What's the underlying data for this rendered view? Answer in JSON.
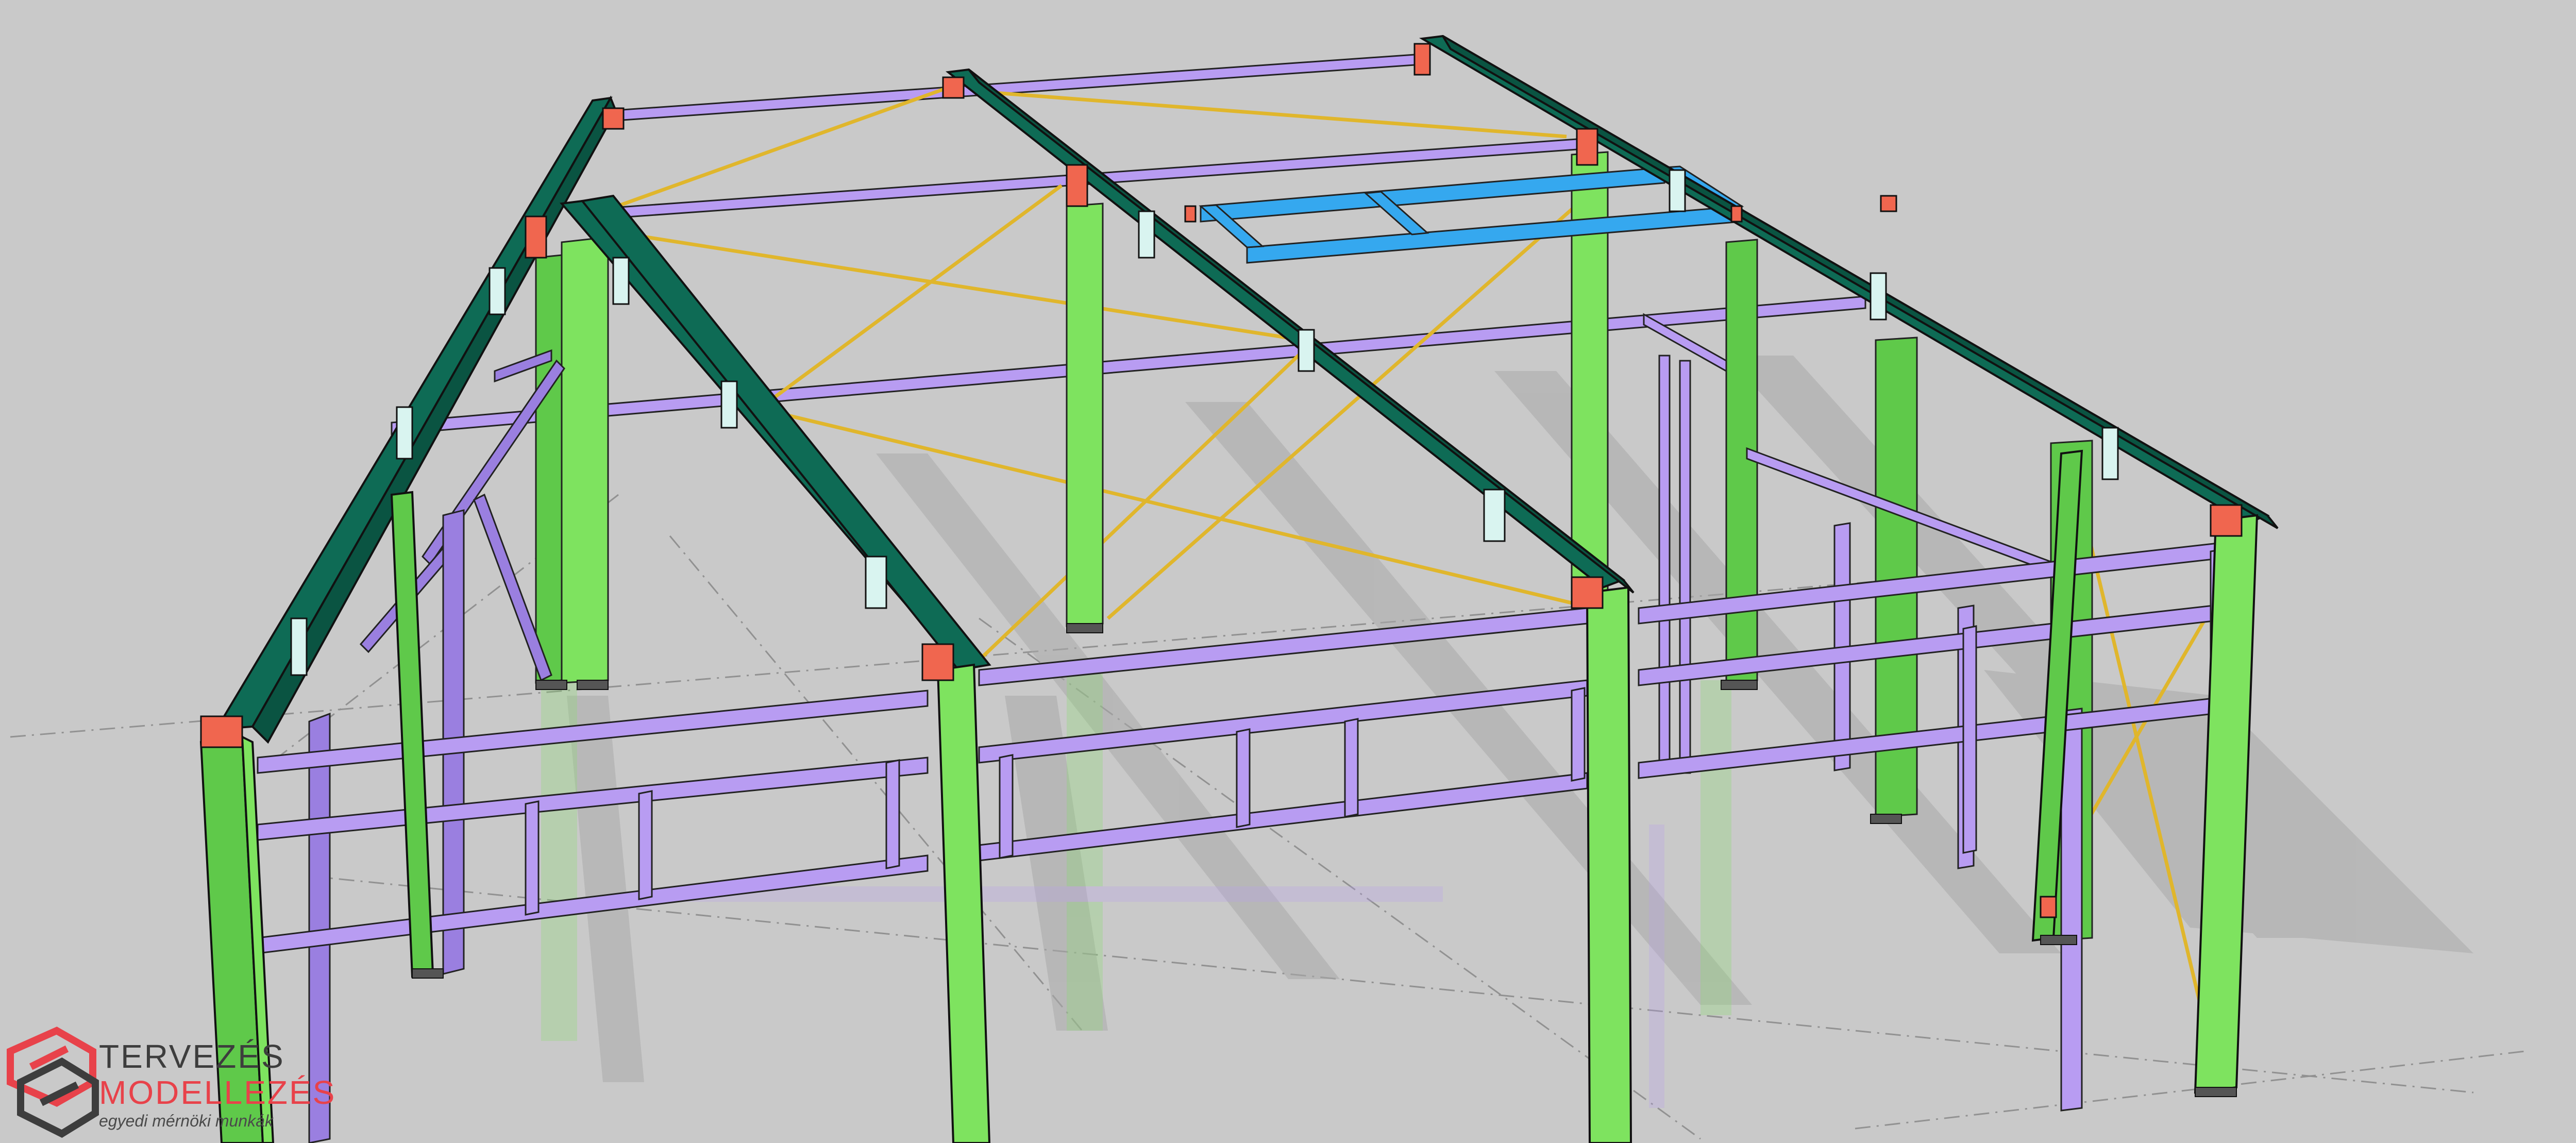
{
  "image": {
    "description_type": "3D steel structure CAD render",
    "colors": {
      "background": "#c9c9c9",
      "rafter": "#0e6b55",
      "column": "#7ee35f",
      "purlin": "#b89cf2",
      "bracing": "#e0b62c",
      "connection_plate": "#f0664f",
      "skylight_frame": "#35a8ef",
      "logo_red": "#e8424a",
      "logo_dark": "#3d3d3d"
    }
  },
  "logo": {
    "line1": "TERVEZÉS",
    "line2": "MODELLEZÉS",
    "line3": "egyedi mérnöki munkák"
  }
}
